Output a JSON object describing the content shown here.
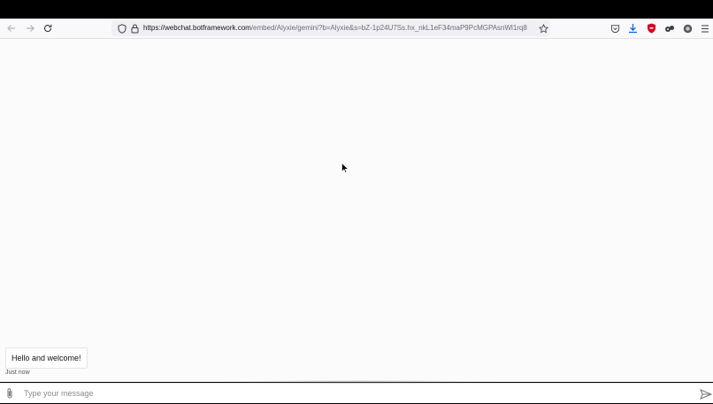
{
  "browser": {
    "url_host": "https://webchat.botframework.com",
    "url_path": "/embed/Alyxie/gemini?b=Alyxie&s=bZ-1p24U7Ss.hx_nkL1eF34maP9PcMGPAsnWl1rq8",
    "icons": [
      "back-arrow-icon",
      "forward-arrow-icon",
      "reload-icon",
      "shield-icon",
      "lock-icon",
      "star-icon",
      "pocket-icon",
      "download-icon",
      "ublock-icon",
      "extension-icon",
      "account-icon",
      "menu-icon"
    ]
  },
  "chat": {
    "messages": [
      {
        "text": "Hello and welcome!",
        "time": "Just now"
      }
    ]
  },
  "sendbox": {
    "placeholder": "Type your message",
    "value": ""
  },
  "colors": {
    "page_bg": "#fbfbfb",
    "toolbar_bg": "#f9f9fb",
    "urlbar_bg": "#f0f0f4",
    "shield_red": "#d70022",
    "download_blue": "#0060df"
  }
}
